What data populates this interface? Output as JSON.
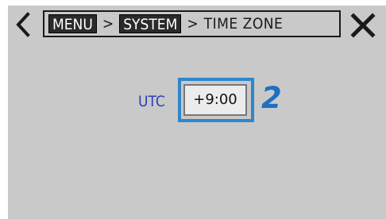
{
  "breadcrumb": {
    "menu": "MENU",
    "system": "SYSTEM",
    "separator": ">",
    "current": "TIME ZONE"
  },
  "timezone": {
    "label": "UTC",
    "value": "+9:00"
  },
  "annotation": {
    "step": "2"
  },
  "colors": {
    "screen_bg": "#c9c9c9",
    "utc_label": "#2d3fb0",
    "highlight": "#2f86c9",
    "step_number": "#1e6fc0"
  },
  "icons": {
    "back": "chevron-left-icon",
    "close": "close-icon"
  }
}
